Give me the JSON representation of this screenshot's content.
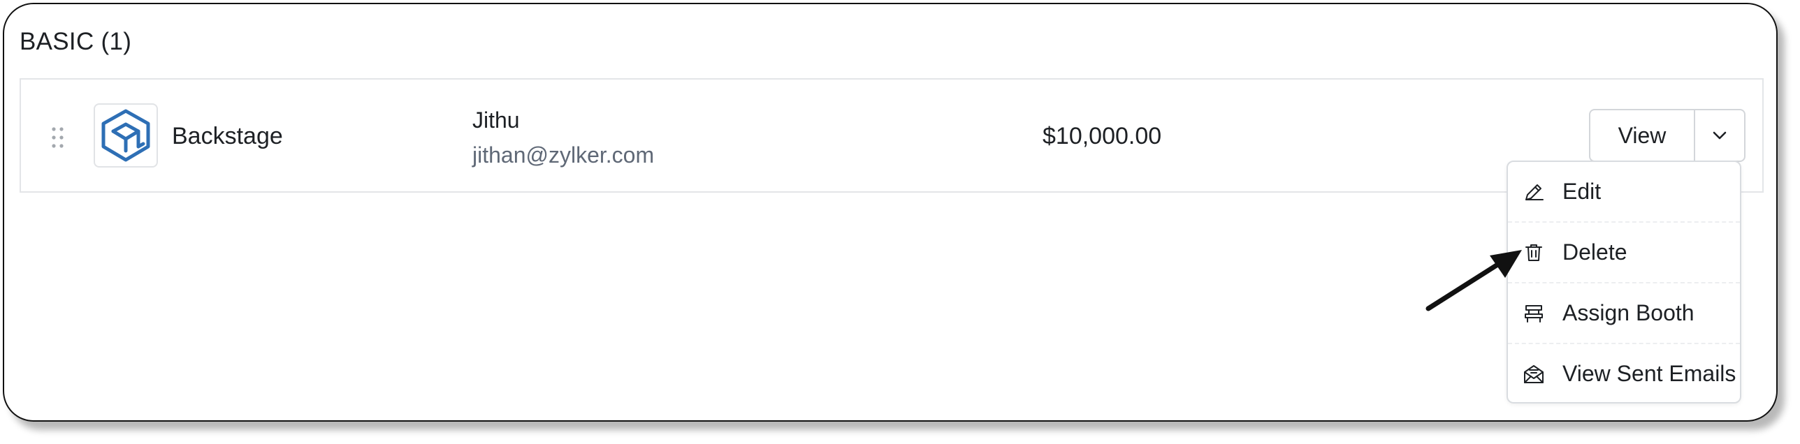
{
  "section": {
    "title": "BASIC (1)"
  },
  "row": {
    "sponsor_name": "Backstage",
    "contact_name": "Jithu",
    "contact_email": "jithan@zylker.com",
    "amount": "$10,000.00",
    "logo_icon": "cube-logo-icon",
    "drag_icon": "drag-handle-icon"
  },
  "actions": {
    "view_label": "View",
    "caret_icon": "chevron-down-icon"
  },
  "menu": {
    "items": [
      {
        "label": "Edit",
        "icon": "pencil-icon"
      },
      {
        "label": "Delete",
        "icon": "trash-icon"
      },
      {
        "label": "Assign Booth",
        "icon": "booth-icon"
      },
      {
        "label": "View Sent Emails",
        "icon": "envelope-open-icon"
      }
    ]
  },
  "colors": {
    "logo_blue": "#2e6fb5",
    "text": "#1d2024",
    "muted_text": "#5f6876",
    "border": "#d3d6da"
  }
}
